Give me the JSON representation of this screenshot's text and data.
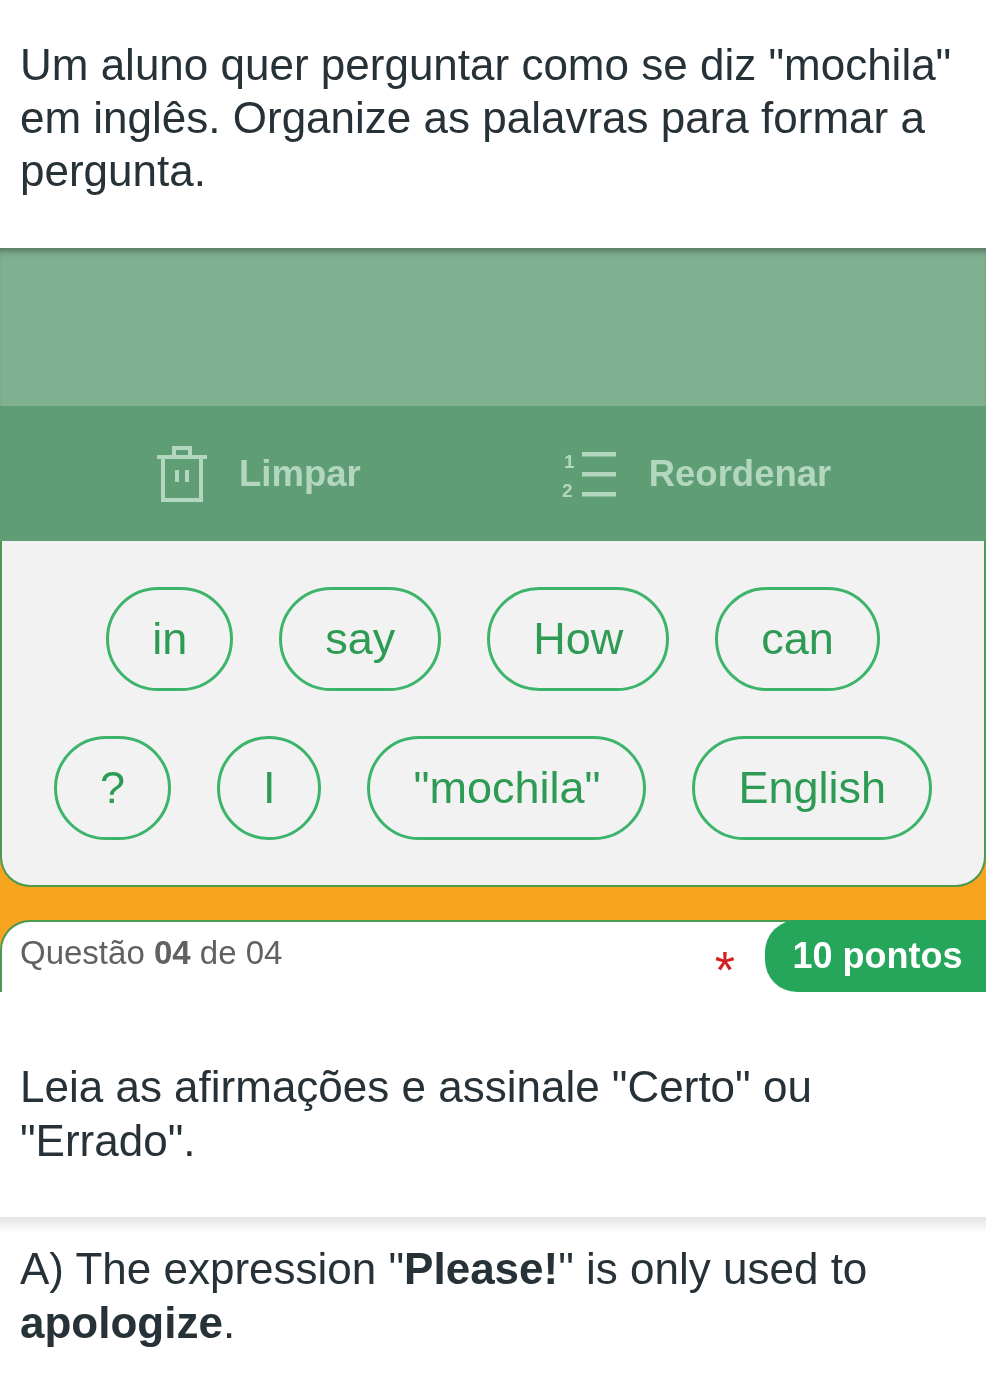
{
  "prompt": "Um aluno quer perguntar como se diz \"mochila\" em inglês. Organize as palavras para formar a pergunta.",
  "toolbar": [
    {
      "kind": "clear",
      "label": "Limpar",
      "disabled": true
    },
    {
      "kind": "reorder",
      "label": "Reordenar",
      "disabled": true,
      "icon_numerals": [
        "1",
        "2"
      ]
    }
  ],
  "word_bank": [
    "in",
    "say",
    "How",
    "can",
    "?",
    "I",
    "\"mochila\"",
    "English"
  ],
  "question_header": {
    "label": "Questão **04** de 04",
    "required_mark": "*",
    "points": "10 pontos"
  },
  "instruction": "Leia as afirmações e assinale \"Certo\" ou \"Errado\".",
  "statement": "A) The expression \"**Please!**\" is only used to **apologize**."
}
